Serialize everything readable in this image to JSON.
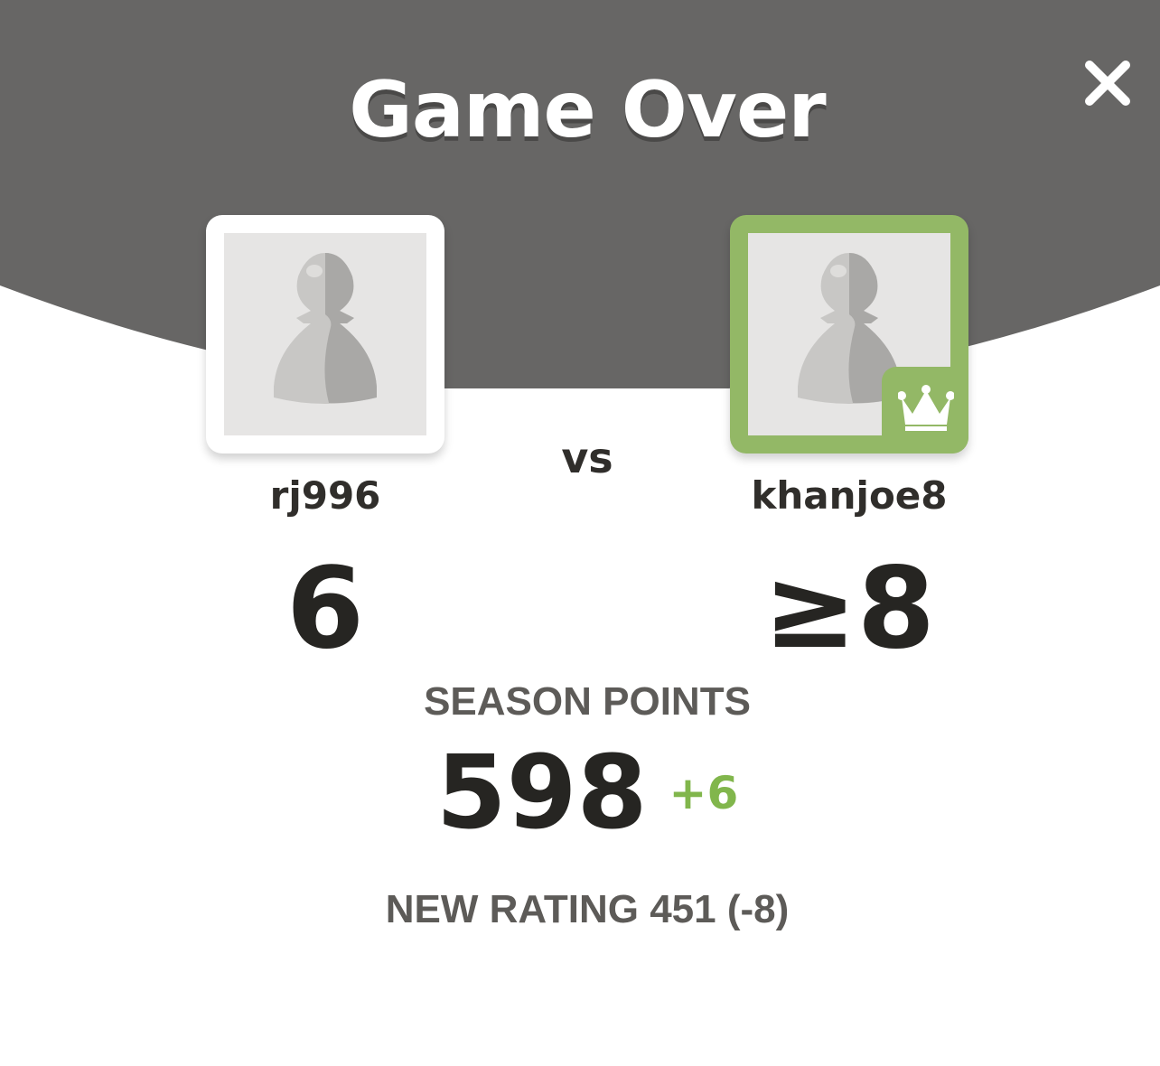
{
  "title": "Game Over",
  "icons": {
    "close": "close-icon",
    "avatar": "pawn-icon",
    "winner_badge": "crown-icon"
  },
  "colors": {
    "header_bg": "#676665",
    "winner_accent": "#93b866",
    "delta_positive": "#81b64c"
  },
  "vs_label": "vs",
  "players": [
    {
      "username": "rj996",
      "score": "6",
      "winner": false
    },
    {
      "username": "khanjoe8",
      "score": "≥8",
      "winner": true
    }
  ],
  "season_points": {
    "label": "SEASON POINTS",
    "value": "598",
    "delta": "+6"
  },
  "new_rating": "NEW RATING 451 (-8)"
}
